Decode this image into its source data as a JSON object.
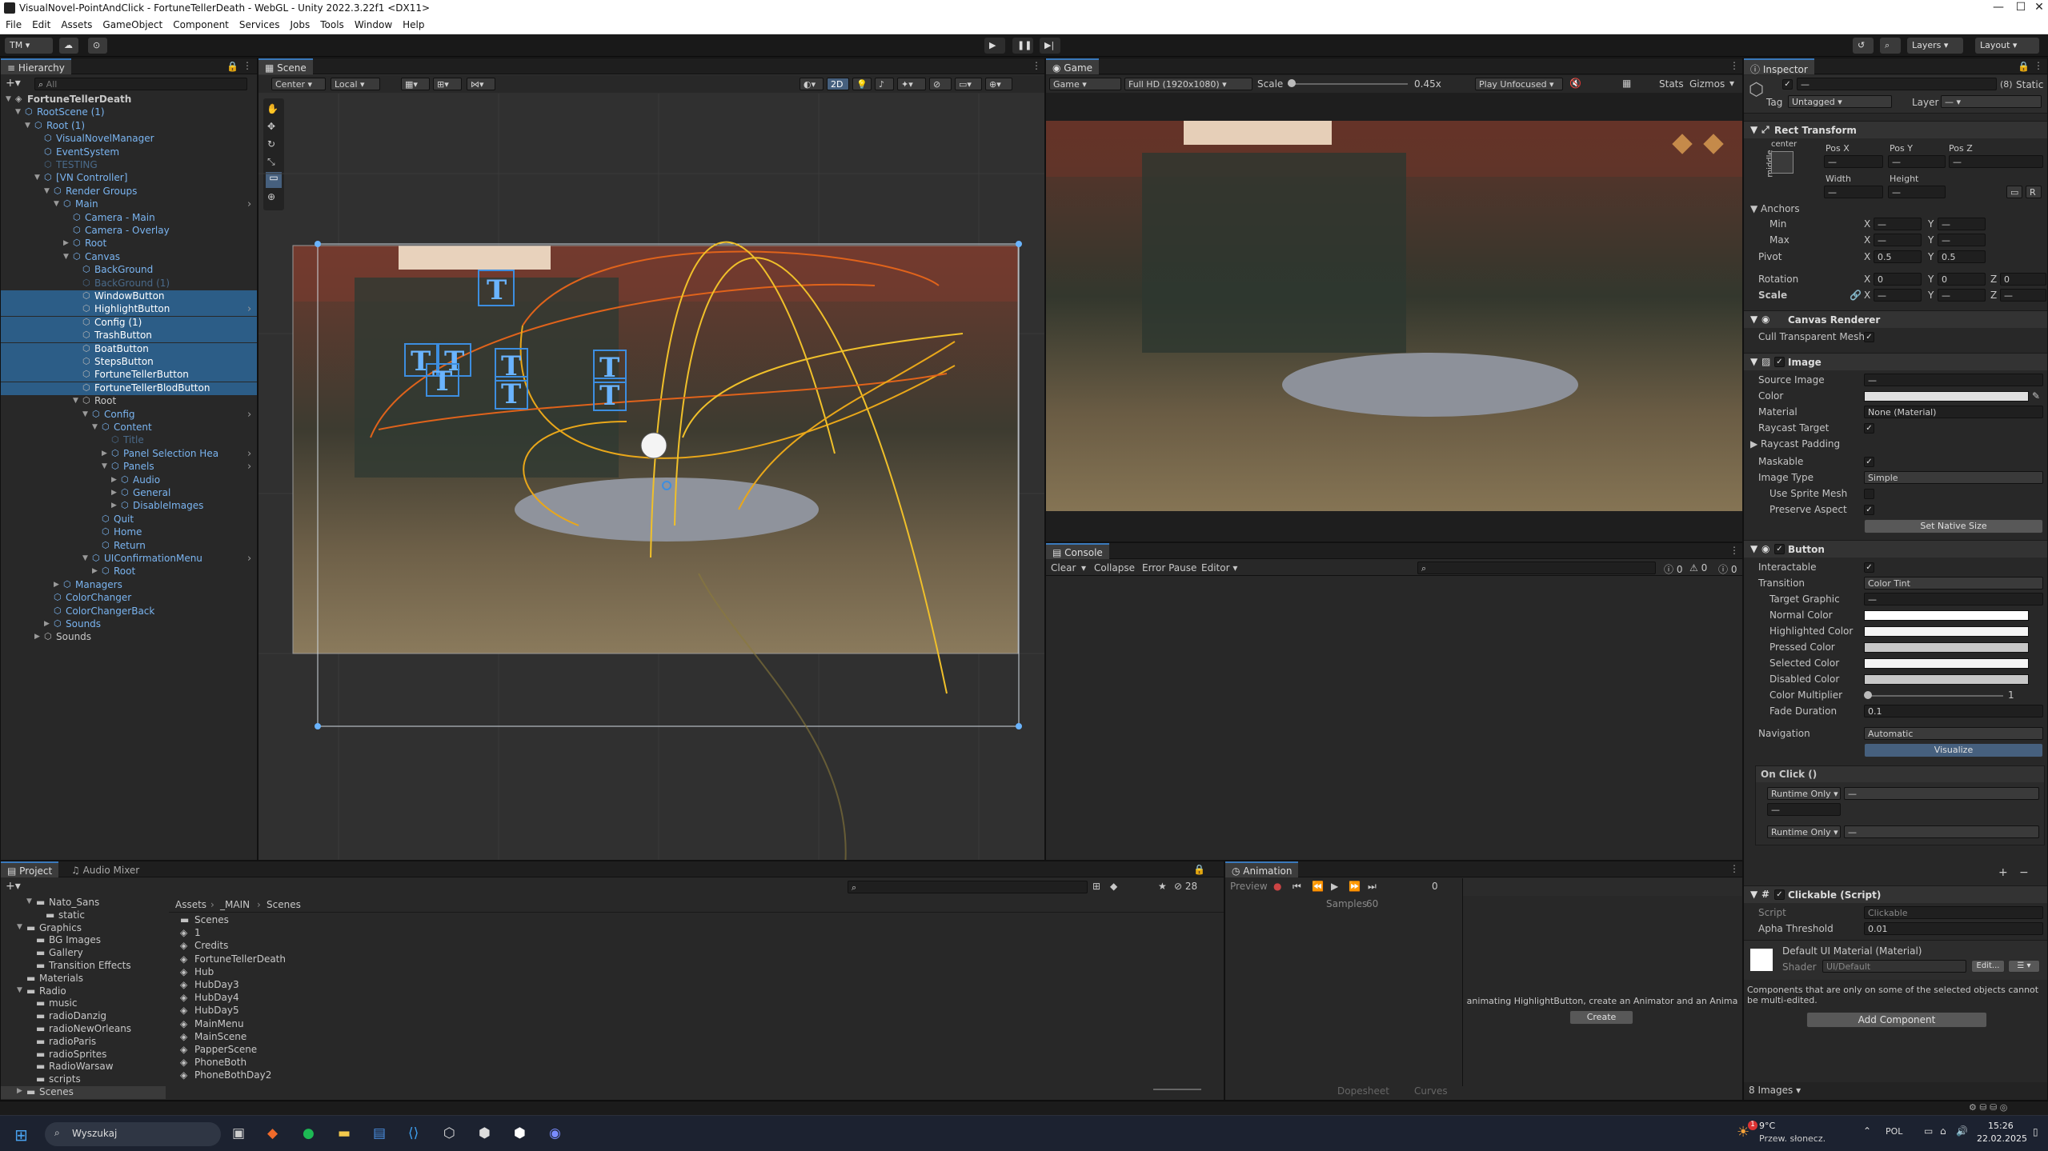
{
  "window": {
    "title": "VisualNovel-PointAndClick - FortuneTellerDeath - WebGL - Unity 2022.3.22f1 <DX11>"
  },
  "menu": [
    "File",
    "Edit",
    "Assets",
    "GameObject",
    "Component",
    "Services",
    "Jobs",
    "Tools",
    "Window",
    "Help"
  ],
  "toolbar": {
    "account": "TM",
    "layers": "Layers",
    "layout": "Layout"
  },
  "hierarchy": {
    "tab": "Hierarchy",
    "search_placeholder": "All",
    "items": [
      {
        "label": "FortuneTellerDeath",
        "indent": 0,
        "bold": true,
        "arrow": "▼",
        "cube": "unity"
      },
      {
        "label": "RootScene (1)",
        "indent": 1,
        "color": "#7ab4f0",
        "arrow": "▼"
      },
      {
        "label": "Root (1)",
        "indent": 2,
        "color": "#7ab4f0",
        "arrow": "▼"
      },
      {
        "label": "VisualNovelManager",
        "indent": 3,
        "color": "#7ab4f0"
      },
      {
        "label": "EventSystem",
        "indent": 3,
        "color": "#7ab4f0"
      },
      {
        "label": "TESTING",
        "indent": 3,
        "color": "#4a6a8a"
      },
      {
        "label": "[VN Controller]",
        "indent": 3,
        "color": "#7ab4f0",
        "arrow": "▼"
      },
      {
        "label": "Render Groups",
        "indent": 4,
        "color": "#7ab4f0",
        "arrow": "▼"
      },
      {
        "label": "Main",
        "indent": 5,
        "color": "#7ab4f0",
        "arrow": "▼",
        "chev": true
      },
      {
        "label": "Camera - Main",
        "indent": 6,
        "color": "#7ab4f0"
      },
      {
        "label": "Camera - Overlay",
        "indent": 6,
        "color": "#7ab4f0"
      },
      {
        "label": "Root",
        "indent": 6,
        "color": "#7ab4f0",
        "arrow": "▶"
      },
      {
        "label": "Canvas",
        "indent": 6,
        "color": "#7ab4f0",
        "arrow": "▼"
      },
      {
        "label": "BackGround",
        "indent": 7,
        "color": "#7ab4f0"
      },
      {
        "label": "BackGround (1)",
        "indent": 7,
        "color": "#4a6a8a"
      },
      {
        "label": "WindowButton",
        "indent": 7,
        "color": "#ffffff",
        "sel": true
      },
      {
        "label": "HighlightButton",
        "indent": 7,
        "color": "#ffffff",
        "sel": true,
        "chev": true
      },
      {
        "label": "Config (1)",
        "indent": 7,
        "color": "#ffffff",
        "sel": true
      },
      {
        "label": "TrashButton",
        "indent": 7,
        "color": "#ffffff",
        "sel": true
      },
      {
        "label": "BoatButton",
        "indent": 7,
        "color": "#ffffff",
        "sel": true
      },
      {
        "label": "StepsButton",
        "indent": 7,
        "color": "#ffffff",
        "sel": true
      },
      {
        "label": "FortuneTellerButton",
        "indent": 7,
        "color": "#ffffff",
        "sel": true
      },
      {
        "label": "FortuneTellerBlodButton",
        "indent": 7,
        "color": "#ffffff",
        "sel": true
      },
      {
        "label": "Root",
        "indent": 7,
        "color": "#c8c8c8",
        "arrow": "▼"
      },
      {
        "label": "Config",
        "indent": 8,
        "color": "#7ab4f0",
        "arrow": "▼",
        "chev": true
      },
      {
        "label": "Content",
        "indent": 9,
        "color": "#7ab4f0",
        "arrow": "▼"
      },
      {
        "label": "Title",
        "indent": 10,
        "color": "#4a6a8a"
      },
      {
        "label": "Panel Selection Hea",
        "indent": 10,
        "color": "#7ab4f0",
        "arrow": "▶",
        "chev": true
      },
      {
        "label": "Panels",
        "indent": 10,
        "color": "#7ab4f0",
        "arrow": "▼",
        "chev": true
      },
      {
        "label": "Audio",
        "indent": 11,
        "color": "#7ab4f0",
        "arrow": "▶"
      },
      {
        "label": "General",
        "indent": 11,
        "color": "#7ab4f0",
        "arrow": "▶"
      },
      {
        "label": "DisableImages",
        "indent": 11,
        "color": "#7ab4f0",
        "arrow": "▶"
      },
      {
        "label": "Quit",
        "indent": 9,
        "color": "#7ab4f0"
      },
      {
        "label": "Home",
        "indent": 9,
        "color": "#7ab4f0"
      },
      {
        "label": "Return",
        "indent": 9,
        "color": "#7ab4f0"
      },
      {
        "label": "UIConfirmationMenu",
        "indent": 8,
        "color": "#7ab4f0",
        "arrow": "▼",
        "chev": true
      },
      {
        "label": "Root",
        "indent": 9,
        "color": "#7ab4f0",
        "arrow": "▶"
      },
      {
        "label": "Managers",
        "indent": 5,
        "color": "#7ab4f0",
        "arrow": "▶"
      },
      {
        "label": "ColorChanger",
        "indent": 4,
        "color": "#7ab4f0"
      },
      {
        "label": "ColorChangerBack",
        "indent": 4,
        "color": "#7ab4f0"
      },
      {
        "label": "Sounds",
        "indent": 4,
        "color": "#7ab4f0",
        "arrow": "▶"
      },
      {
        "label": "Sounds",
        "indent": 3,
        "color": "#c8c8c8",
        "arrow": "▶"
      }
    ]
  },
  "scene": {
    "tab": "Scene",
    "pivot": "Center",
    "space": "Local",
    "mode2d": "2D"
  },
  "game": {
    "tab": "Game",
    "display": "Game",
    "resolution": "Full HD (1920x1080)",
    "scale_label": "Scale",
    "scale_value": "0.45x",
    "play_mode": "Play Unfocused",
    "stats": "Stats",
    "gizmos": "Gizmos"
  },
  "console": {
    "tab": "Console",
    "clear": "Clear",
    "collapse": "Collapse",
    "error_pause": "Error Pause",
    "editor": "Editor",
    "counts": [
      "0",
      "0",
      "0"
    ]
  },
  "inspector": {
    "tab": "Inspector",
    "static": "Static",
    "multi_count": "(8)",
    "tag_label": "Tag",
    "tag_value": "Untagged",
    "layer_label": "Layer",
    "rect_transform": {
      "title": "Rect Transform",
      "anchor_h": "center",
      "anchor_v": "middle",
      "pos_x": "Pos X",
      "pos_y": "Pos Y",
      "pos_z": "Pos Z",
      "width": "Width",
      "height": "Height",
      "anchors": "Anchors",
      "min": "Min",
      "max": "Max",
      "pivot": "Pivot",
      "pivot_x": "0.5",
      "pivot_y": "0.5",
      "rotation": "Rotation",
      "rot_x": "0",
      "rot_y": "0",
      "rot_z": "0",
      "scale": "Scale"
    },
    "canvas_renderer": {
      "title": "Canvas Renderer",
      "cull": "Cull Transparent Mesh"
    },
    "image": {
      "title": "Image",
      "source_image": "Source Image",
      "color": "Color",
      "material": "Material",
      "material_value": "None (Material)",
      "raycast_target": "Raycast Target",
      "raycast_padding": "Raycast Padding",
      "maskable": "Maskable",
      "image_type": "Image Type",
      "image_type_value": "Simple",
      "use_sprite_mesh": "Use Sprite Mesh",
      "preserve_aspect": "Preserve Aspect",
      "set_native": "Set Native Size"
    },
    "button": {
      "title": "Button",
      "interactable": "Interactable",
      "transition": "Transition",
      "transition_value": "Color Tint",
      "target_graphic": "Target Graphic",
      "normal": "Normal Color",
      "highlighted": "Highlighted Color",
      "pressed": "Pressed Color",
      "selected": "Selected Color",
      "disabled": "Disabled Color",
      "multiplier": "Color Multiplier",
      "multiplier_value": "1",
      "fade": "Fade Duration",
      "fade_value": "0.1",
      "navigation": "Navigation",
      "navigation_value": "Automatic",
      "visualize": "Visualize",
      "onclick": "On Click ()",
      "runtime1": "Runtime Only",
      "runtime2": "Runtime Only"
    },
    "clickable": {
      "title": "Clickable (Script)",
      "script": "Script",
      "script_value": "Clickable",
      "alpha": "Apha Threshold",
      "alpha_value": "0.01"
    },
    "material": {
      "title": "Default UI Material (Material)",
      "shader": "Shader",
      "shader_value": "UI/Default",
      "edit": "Edit..."
    },
    "note": "Components that are only on some of the selected objects cannot be multi-edited.",
    "add_component": "Add Component",
    "footer": "8 Images"
  },
  "project": {
    "tab": "Project",
    "tab2": "Audio Mixer",
    "breadcrumb": [
      "Assets",
      "_MAIN",
      "Scenes"
    ],
    "hidden_count": "28",
    "folders": [
      {
        "label": "Nato_Sans",
        "indent": 2,
        "arrow": "▼"
      },
      {
        "label": "static",
        "indent": 3
      },
      {
        "label": "Graphics",
        "indent": 1,
        "arrow": "▼"
      },
      {
        "label": "BG Images",
        "indent": 2
      },
      {
        "label": "Gallery",
        "indent": 2
      },
      {
        "label": "Transition Effects",
        "indent": 2
      },
      {
        "label": "Materials",
        "indent": 1
      },
      {
        "label": "Radio",
        "indent": 1,
        "arrow": "▼"
      },
      {
        "label": "music",
        "indent": 2
      },
      {
        "label": "radioDanzig",
        "indent": 2
      },
      {
        "label": "radioNewOrleans",
        "indent": 2
      },
      {
        "label": "radioParis",
        "indent": 2
      },
      {
        "label": "radioSprites",
        "indent": 2
      },
      {
        "label": "RadioWarsaw",
        "indent": 2
      },
      {
        "label": "scripts",
        "indent": 2
      },
      {
        "label": "Scenes",
        "indent": 1,
        "arrow": "▶",
        "sel": true
      }
    ],
    "files": [
      {
        "label": "Scenes",
        "icon": "folder"
      },
      {
        "label": "1",
        "icon": "unity"
      },
      {
        "label": "Credits",
        "icon": "unity"
      },
      {
        "label": "FortuneTellerDeath",
        "icon": "unity"
      },
      {
        "label": "Hub",
        "icon": "unity"
      },
      {
        "label": "HubDay3",
        "icon": "unity"
      },
      {
        "label": "HubDay4",
        "icon": "unity"
      },
      {
        "label": "HubDay5",
        "icon": "unity"
      },
      {
        "label": "MainMenu",
        "icon": "unity"
      },
      {
        "label": "MainScene",
        "icon": "unity"
      },
      {
        "label": "PapperScene",
        "icon": "unity"
      },
      {
        "label": "PhoneBoth",
        "icon": "unity"
      },
      {
        "label": "PhoneBothDay2",
        "icon": "unity"
      }
    ]
  },
  "animation": {
    "tab": "Animation",
    "preview": "Preview",
    "frame": "0",
    "samples": "Samples",
    "samples_value": "60",
    "message": "animating HighlightButton, create an Animator and an Anima",
    "create": "Create",
    "dopesheet": "Dopesheet",
    "curves": "Curves"
  },
  "taskbar": {
    "search": "Wyszukaj",
    "weather_temp": "9°C",
    "weather_desc": "Przew. słonecz.",
    "lang": "POL",
    "time": "15:26",
    "date": "22.02.2025",
    "notif": "1"
  }
}
